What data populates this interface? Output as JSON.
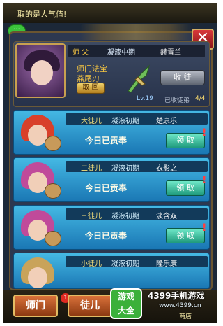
{
  "banner": {
    "text": "取的是人气值!"
  },
  "chat_icon": "chat-icon",
  "master": {
    "label_master": "师 父",
    "stage": "凝液中期",
    "name": "赫雪兰",
    "treasure_title": "师门法宝",
    "treasure_name": "燕尾刃",
    "take_back": "取 回",
    "level": "Lv.19",
    "accept_button": "收 徒",
    "accepted_label": "已收徒弟",
    "accepted_count": "4/4"
  },
  "disciples": [
    {
      "rank": "大徒儿",
      "stage": "凝液初期",
      "name": "楚康乐",
      "status": "今日已贡奉",
      "claim": "领 取",
      "hair_color": "#d8402a"
    },
    {
      "rank": "二徒儿",
      "stage": "凝液初期",
      "name": "衣影之",
      "status": "今日已贡奉",
      "claim": "领 取",
      "hair_color": "#c04a9a"
    },
    {
      "rank": "三徒儿",
      "stage": "凝液初期",
      "name": "淡含双",
      "status": "今日已贡奉",
      "claim": "领 取",
      "hair_color": "#c04a9a"
    },
    {
      "rank": "小徒儿",
      "stage": "凝液初期",
      "name": "隆乐康",
      "hair_color": "#c9a35a"
    }
  ],
  "bottom": {
    "tab_master": "师门",
    "tab_disciple": "徒儿",
    "badge": "1",
    "shop": "商店"
  },
  "watermark": {
    "logo_line1": "游戏",
    "logo_line2": "大全",
    "title": "4399手机游戏",
    "url": "www.4399.cn"
  },
  "colors": {
    "accent": "#f5c542",
    "close": "#c8282a",
    "claim": "#2fb896"
  }
}
